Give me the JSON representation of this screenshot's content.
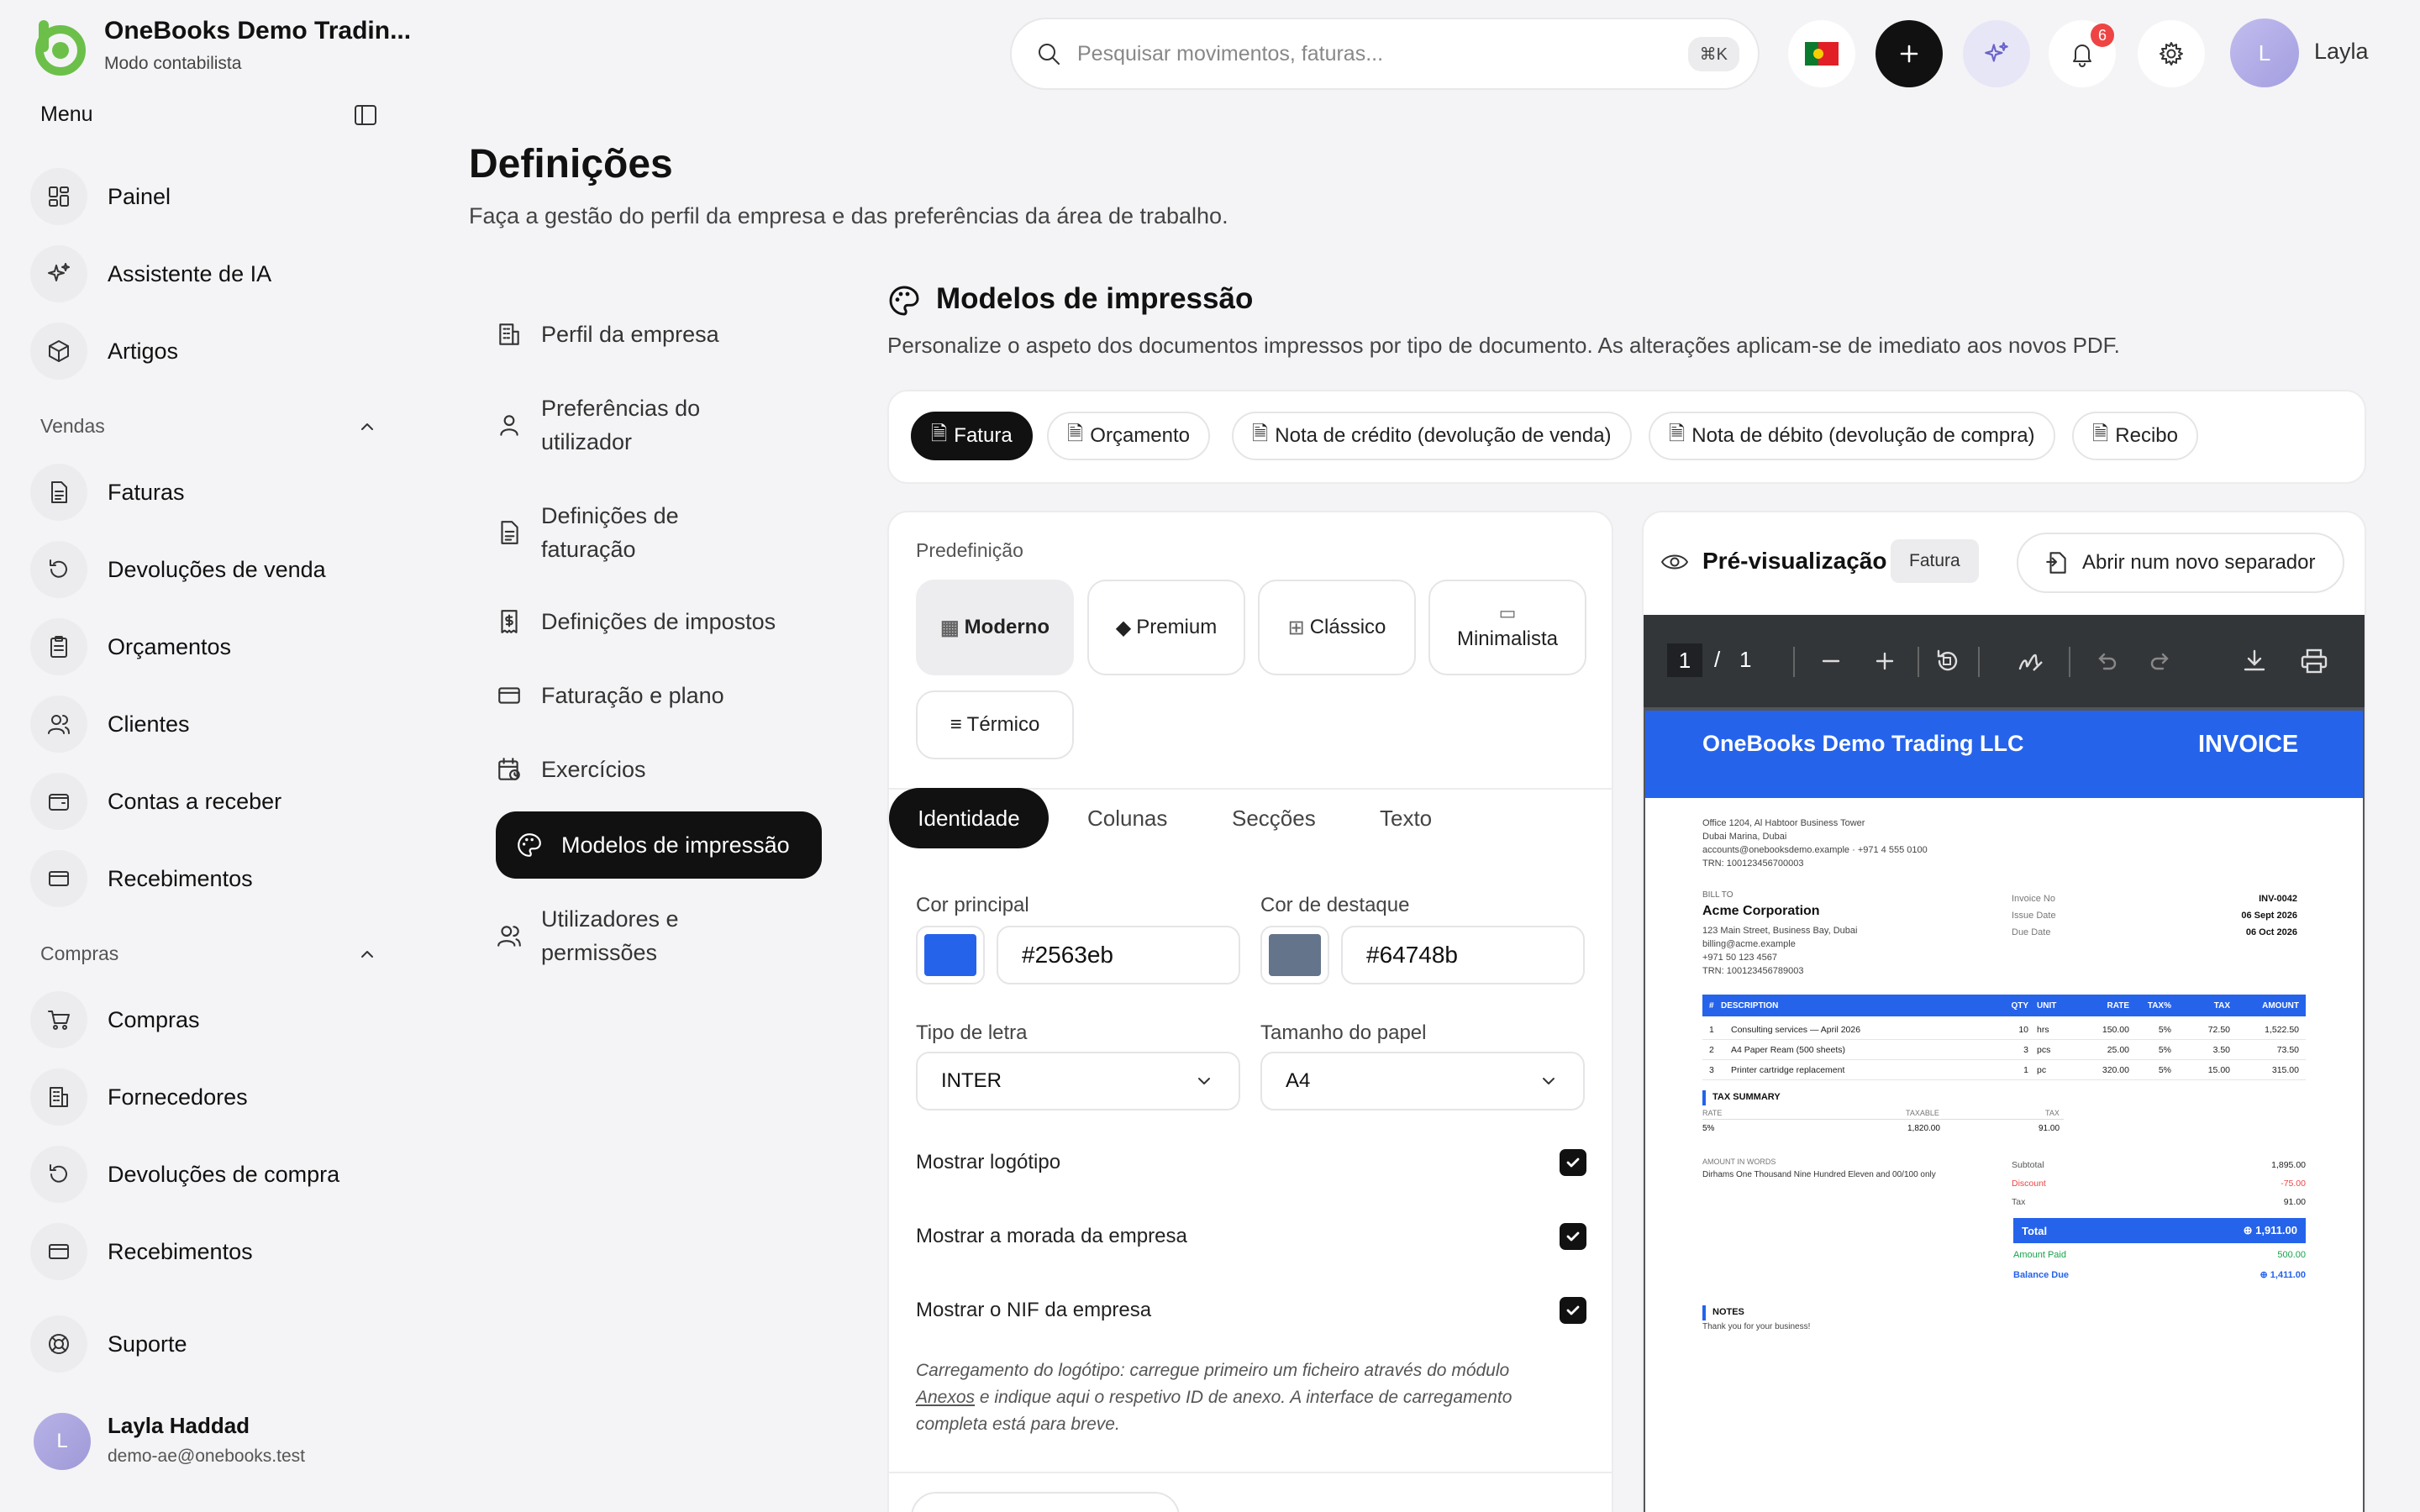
{
  "app": {
    "company_name": "OneBooks Demo Tradin...",
    "mode": "Modo contabilista"
  },
  "sidebar": {
    "menu_label": "Menu",
    "top_items": [
      {
        "label": "Painel",
        "icon": "dashboard-icon"
      },
      {
        "label": "Assistente de IA",
        "icon": "sparkles-icon"
      },
      {
        "label": "Artigos",
        "icon": "box-icon"
      }
    ],
    "sales_header": "Vendas",
    "sales_items": [
      {
        "label": "Faturas"
      },
      {
        "label": "Devoluções de venda"
      },
      {
        "label": "Orçamentos"
      },
      {
        "label": "Clientes"
      },
      {
        "label": "Contas a receber"
      },
      {
        "label": "Recebimentos"
      }
    ],
    "purchases_header": "Compras",
    "purchase_items": [
      {
        "label": "Compras"
      },
      {
        "label": "Fornecedores"
      },
      {
        "label": "Devoluções de compra"
      },
      {
        "label": "Recebimentos"
      }
    ],
    "support": "Suporte",
    "user": {
      "initial": "L",
      "name": "Layla Haddad",
      "email": "demo-ae@onebooks.test"
    }
  },
  "topbar": {
    "search_placeholder": "Pesquisar movimentos, faturas...",
    "shortcut": "⌘K",
    "notifications": "6",
    "user_initial": "L",
    "user_name": "Layla"
  },
  "page": {
    "title": "Definições",
    "subtitle": "Faça a gestão do perfil da empresa e das preferências da área de trabalho."
  },
  "settings_nav": [
    {
      "label": "Perfil da empresa"
    },
    {
      "label": "Preferências do utilizador"
    },
    {
      "label": "Definições de faturação"
    },
    {
      "label": "Definições de impostos"
    },
    {
      "label": "Faturação e plano"
    },
    {
      "label": "Exercícios"
    },
    {
      "label": "Modelos de impressão"
    },
    {
      "label": "Utilizadores e permissões"
    }
  ],
  "section": {
    "title": "Modelos de impressão",
    "description": "Personalize o aspeto dos documentos impressos por tipo de documento. As alterações aplicam-se de imediato aos novos PDF."
  },
  "doc_types": [
    "Fatura",
    "Orçamento",
    "Nota de crédito (devolução de venda)",
    "Nota de débito (devolução de compra)",
    "Recibo"
  ],
  "preset": {
    "label": "Predefinição",
    "options": [
      {
        "icon": "▦",
        "label": "Moderno"
      },
      {
        "icon": "◆",
        "label": "Premium"
      },
      {
        "icon": "⊞",
        "label": "Clássico"
      },
      {
        "icon": "▭",
        "label": "Minimalista"
      },
      {
        "icon": "≡",
        "label": "Térmico"
      }
    ]
  },
  "editor_tabs": [
    "Identidade",
    "Colunas",
    "Secções",
    "Texto"
  ],
  "identity": {
    "primary_label": "Cor principal",
    "primary_value": "#2563eb",
    "accent_label": "Cor de destaque",
    "accent_value": "#64748b",
    "font_label": "Tipo de letra",
    "font_value": "INTER",
    "paper_label": "Tamanho do papel",
    "paper_value": "A4",
    "show_logo": "Mostrar logótipo",
    "show_address": "Mostrar a morada da empresa",
    "show_tax_id": "Mostrar o NIF da empresa",
    "note_pre": "Carregamento do logótipo: carregue primeiro um ficheiro através do módulo",
    "note_link": "Anexos",
    "note_post": "e indique aqui o respetivo ID de anexo. A interface de carregamento completa está para breve."
  },
  "preview": {
    "title": "Pré-visualização",
    "badge": "Fatura",
    "open_button": "Abrir num novo separador",
    "page_current": "1",
    "page_sep": "/",
    "page_total": "1"
  },
  "invoice": {
    "company": "OneBooks Demo Trading LLC",
    "doc_title": "INVOICE",
    "address": [
      "Office 1204, Al Habtoor Business Tower",
      "Dubai Marina, Dubai",
      "accounts@onebooksdemo.example  ·  +971 4 555 0100",
      "TRN: 100123456700003"
    ],
    "bill_to_label": "BILL TO",
    "customer": "Acme Corporation",
    "customer_address": [
      "123 Main Street, Business Bay, Dubai",
      "billing@acme.example",
      "+971 50 123 4567",
      "TRN: 100123456789003"
    ],
    "meta": [
      {
        "k": "Invoice No",
        "v": "INV-0042"
      },
      {
        "k": "Issue Date",
        "v": "06 Sept 2026"
      },
      {
        "k": "Due Date",
        "v": "06 Oct 2026"
      }
    ],
    "columns": [
      "#",
      "DESCRIPTION",
      "QTY",
      "UNIT",
      "RATE",
      "TAX%",
      "TAX",
      "AMOUNT"
    ],
    "rows": [
      [
        "1",
        "Consulting services — April 2026",
        "10",
        "hrs",
        "150.00",
        "5%",
        "72.50",
        "1,522.50"
      ],
      [
        "2",
        "A4 Paper Ream (500 sheets)",
        "3",
        "pcs",
        "25.00",
        "5%",
        "3.50",
        "73.50"
      ],
      [
        "3",
        "Printer cartridge replacement",
        "1",
        "pc",
        "320.00",
        "5%",
        "15.00",
        "315.00"
      ]
    ],
    "tax_summary_label": "TAX SUMMARY",
    "tax_cols": [
      "RATE",
      "TAXABLE",
      "TAX"
    ],
    "tax_row": [
      "5%",
      "1,820.00",
      "91.00"
    ],
    "words_label": "AMOUNT IN WORDS",
    "words": "Dirhams One Thousand Nine Hundred Eleven and 00/100 only",
    "subtotal_label": "Subtotal",
    "subtotal": "1,895.00",
    "discount_label": "Discount",
    "discount": "-75.00",
    "tax_label": "Tax",
    "tax": "91.00",
    "total_label": "Total",
    "total": "⊕ 1,911.00",
    "paid_label": "Amount Paid",
    "paid": "500.00",
    "balance_label": "Balance Due",
    "balance": "⊕ 1,411.00",
    "notes_label": "NOTES",
    "notes": "Thank you for your business!"
  },
  "colors": {
    "primary": "#2563eb",
    "accent": "#64748b",
    "badge": "#ef4444"
  }
}
